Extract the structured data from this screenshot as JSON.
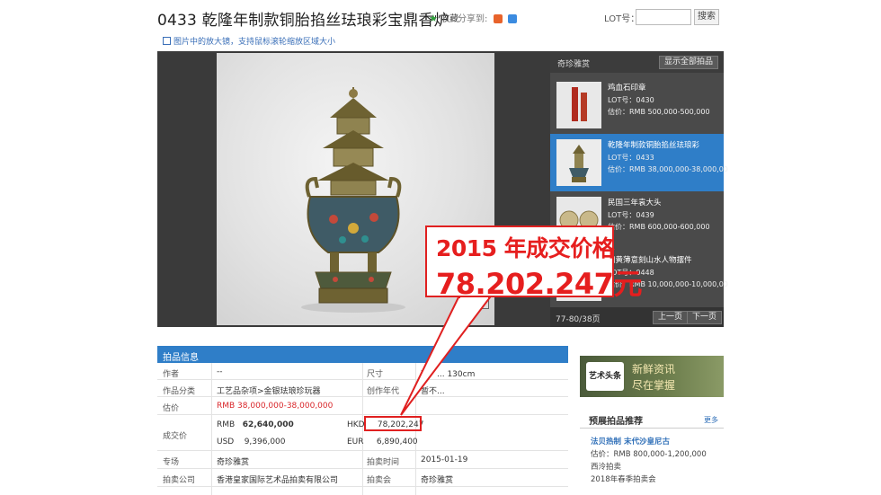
{
  "header": {
    "title": "0433 乾隆年制款铜胎掐丝珐琅彩宝鼎香炉",
    "favorite_label": "收藏",
    "share_label": "分享到:",
    "lot_label": "LOT号：",
    "lot_value": "",
    "search_button": "搜索"
  },
  "hint": "图片中的放大镜，支持鼠标滚轮缩放区域大小",
  "panel": {
    "title": "奇珍雅赏",
    "show_all": "显示全部拍品",
    "items": [
      {
        "name": "鸡血石印章",
        "lot": "LOT号：0430",
        "estimate": "估价：RMB 500,000-500,000"
      },
      {
        "name": "乾隆年制款铜胎掐丝珐琅彩",
        "lot": "LOT号：0433",
        "estimate": "估价：RMB 38,000,000-38,000,00"
      },
      {
        "name": "民国三年袁大头",
        "lot": "LOT号：0439",
        "estimate": "估价：RMB 600,000-600,000"
      },
      {
        "name": "田黄薄意刻山水人物摆件",
        "lot": "LOT号：0448",
        "estimate": "估价：RMB 10,000,000-10,000,00"
      }
    ],
    "page_count": "77-80/38页",
    "prev": "上一页",
    "next": "下一页"
  },
  "callout": {
    "line1": "2015 年成交价格",
    "line2": "78.202.247元"
  },
  "info": {
    "heading": "拍品信息",
    "rows": {
      "author_label": "作者",
      "author_value": "--",
      "size_label": "尺寸",
      "size_value": "高：... 130cm",
      "category_label": "作品分类",
      "category_value": "工艺品杂项>金银珐琅珍玩器",
      "year_label": "创作年代",
      "year_value": "暂不...",
      "estimate_label": "估价",
      "estimate_value": "RMB 38,000,000-38,000,000",
      "deal_label": "成交价",
      "rmb_label": "RMB",
      "rmb_value": "62,640,000",
      "hkd_label": "HKD",
      "hkd_value": "78,202,247",
      "usd_label": "USD",
      "usd_value": "9,396,000",
      "eur_label": "EUR",
      "eur_value": "6,890,400",
      "session_label": "专场",
      "session_value": "奇珍雅赏",
      "date_label": "拍卖时间",
      "date_value": "2015-01-19",
      "company_label": "拍卖公司",
      "company_value": "香港皇家国际艺术品拍卖有限公司",
      "auction_label": "拍卖会",
      "auction_value": "奇珍雅赏"
    }
  },
  "ad": {
    "logo": "艺术头条",
    "line1": "新鲜资讯",
    "line2": "尽在掌握"
  },
  "recommend": {
    "title": "预展拍品推荐",
    "more": "更多",
    "item_name": "法贝热制 末代沙皇尼古",
    "item_estimate": "估价：RMB 800,000-1,200,000",
    "item_house": "西泠拍卖",
    "item_sale": "2018年春季拍卖会"
  },
  "colors": {
    "accent_blue": "#2f7ec8",
    "highlight_red": "#e61e1e"
  }
}
